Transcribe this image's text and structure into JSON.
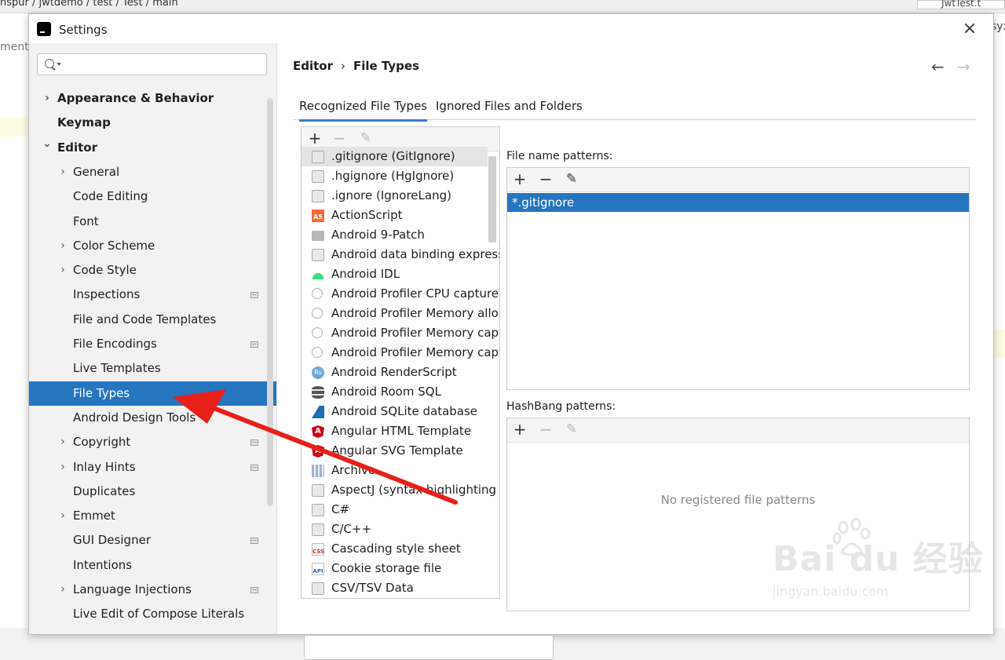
{
  "background": {
    "breadcrumb": "nspur / jwtdemo / test / Test / main",
    "left_text": "ment",
    "right_tab": "JwtTest.t",
    "right_text": "syx"
  },
  "dialog": {
    "title": "Settings",
    "close_glyph": "×"
  },
  "search": {
    "placeholder": "",
    "value": ""
  },
  "sidebar": {
    "items": [
      {
        "label": "Appearance & Behavior",
        "level": 0,
        "arrow": "right",
        "bold": true
      },
      {
        "label": "Keymap",
        "level": 0,
        "arrow": "none",
        "bold": true
      },
      {
        "label": "Editor",
        "level": 0,
        "arrow": "down",
        "bold": true
      },
      {
        "label": "General",
        "level": 1,
        "arrow": "right"
      },
      {
        "label": "Code Editing",
        "level": 1,
        "arrow": "none"
      },
      {
        "label": "Font",
        "level": 1,
        "arrow": "none"
      },
      {
        "label": "Color Scheme",
        "level": 1,
        "arrow": "right"
      },
      {
        "label": "Code Style",
        "level": 1,
        "arrow": "right"
      },
      {
        "label": "Inspections",
        "level": 1,
        "arrow": "none",
        "project_icon": true
      },
      {
        "label": "File and Code Templates",
        "level": 1,
        "arrow": "none"
      },
      {
        "label": "File Encodings",
        "level": 1,
        "arrow": "none",
        "project_icon": true
      },
      {
        "label": "Live Templates",
        "level": 1,
        "arrow": "none"
      },
      {
        "label": "File Types",
        "level": 1,
        "arrow": "none",
        "selected": true
      },
      {
        "label": "Android Design Tools",
        "level": 1,
        "arrow": "none"
      },
      {
        "label": "Copyright",
        "level": 1,
        "arrow": "right",
        "project_icon": true
      },
      {
        "label": "Inlay Hints",
        "level": 1,
        "arrow": "right",
        "project_icon": true
      },
      {
        "label": "Duplicates",
        "level": 1,
        "arrow": "none"
      },
      {
        "label": "Emmet",
        "level": 1,
        "arrow": "right"
      },
      {
        "label": "GUI Designer",
        "level": 1,
        "arrow": "none",
        "project_icon": true
      },
      {
        "label": "Intentions",
        "level": 1,
        "arrow": "none"
      },
      {
        "label": "Language Injections",
        "level": 1,
        "arrow": "right",
        "project_icon": true
      },
      {
        "label": "Live Edit of Compose Literals",
        "level": 1,
        "arrow": "none"
      }
    ]
  },
  "main": {
    "breadcrumb": {
      "parent": "Editor",
      "separator": "›",
      "current": "File Types"
    },
    "nav": {
      "back": "←",
      "forward": "→"
    },
    "tabs": [
      {
        "label": "Recognized File Types",
        "active": true
      },
      {
        "label": "Ignored Files and Folders",
        "active": false
      }
    ],
    "file_types_toolbar": {
      "add": "+",
      "remove": "−",
      "edit": "✎"
    },
    "file_types": [
      {
        "label": ".gitignore (GitIgnore)",
        "icon": "ignore-file-icon",
        "selected": true
      },
      {
        "label": ".hgignore (HgIgnore)",
        "icon": "ignore-file-icon"
      },
      {
        "label": ".ignore (IgnoreLang)",
        "icon": "ignore-file-icon"
      },
      {
        "label": "ActionScript",
        "icon": "actionscript-icon"
      },
      {
        "label": "Android 9-Patch",
        "icon": "folder-icon"
      },
      {
        "label": "Android data binding expressions",
        "icon": "file-person-icon"
      },
      {
        "label": "Android IDL",
        "icon": "android-icon"
      },
      {
        "label": "Android Profiler CPU capture",
        "icon": "profiler-icon"
      },
      {
        "label": "Android Profiler Memory allocation",
        "icon": "profiler-icon"
      },
      {
        "label": "Android Profiler Memory capture",
        "icon": "profiler-icon"
      },
      {
        "label": "Android Profiler Memory capture",
        "icon": "profiler-icon"
      },
      {
        "label": "Android RenderScript",
        "icon": "renderscript-icon"
      },
      {
        "label": "Android Room SQL",
        "icon": "database-icon"
      },
      {
        "label": "Android SQLite database",
        "icon": "sqlite-icon"
      },
      {
        "label": "Angular HTML Template",
        "icon": "angular-icon"
      },
      {
        "label": "Angular SVG Template",
        "icon": "angular-icon"
      },
      {
        "label": "Archive",
        "icon": "archive-icon"
      },
      {
        "label": "AspectJ (syntax highlighting only)",
        "icon": "file-person-icon"
      },
      {
        "label": "C#",
        "icon": "file-person-icon"
      },
      {
        "label": "C/C++",
        "icon": "file-person-icon"
      },
      {
        "label": "Cascading style sheet",
        "icon": "css-icon"
      },
      {
        "label": "Cookie storage file",
        "icon": "api-icon"
      },
      {
        "label": "CSV/TSV Data",
        "icon": "file-person-icon"
      }
    ],
    "file_name_patterns": {
      "label": "File name patterns:",
      "toolbar": {
        "add": "+",
        "remove": "−",
        "edit": "✎"
      },
      "items": [
        "*.gitignore"
      ]
    },
    "hashbang_patterns": {
      "label": "HashBang patterns:",
      "toolbar": {
        "add": "+",
        "remove": "−",
        "edit": "✎"
      },
      "empty_text": "No registered file patterns"
    }
  },
  "watermark": {
    "brand": "Bai  du 经验",
    "url": "jingyan.baidu.com"
  },
  "colors": {
    "selection": "#2675bf",
    "annotation_arrow": "#e8201a",
    "sidebar_bg": "#f2f2f2"
  }
}
